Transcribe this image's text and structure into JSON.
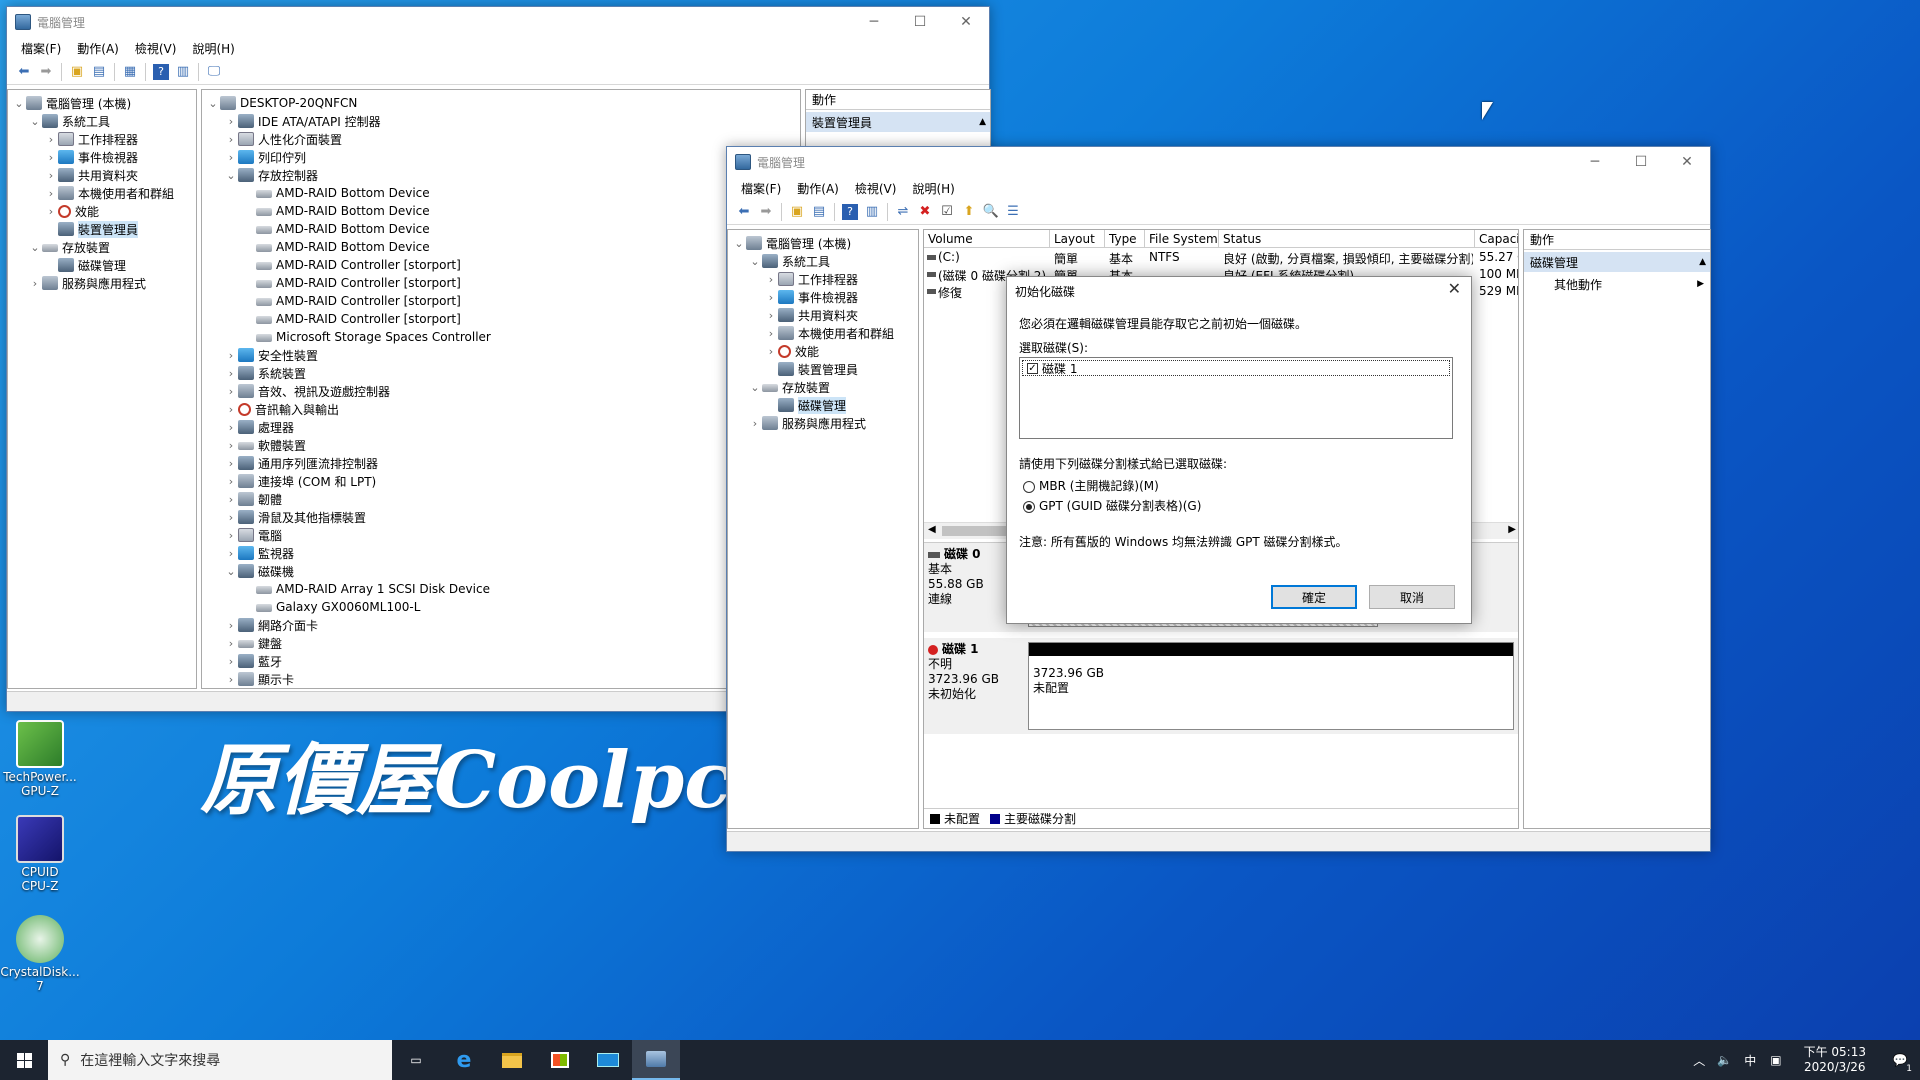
{
  "win1": {
    "title": "電腦管理",
    "menu": [
      "檔案(F)",
      "動作(A)",
      "檢視(V)",
      "說明(H)"
    ],
    "tree": [
      {
        "label": "電腦管理 (本機)",
        "level": 0,
        "exp": "v"
      },
      {
        "label": "系統工具",
        "level": 1,
        "exp": "v"
      },
      {
        "label": "工作排程器",
        "level": 2,
        "exp": ">"
      },
      {
        "label": "事件檢視器",
        "level": 2,
        "exp": ">"
      },
      {
        "label": "共用資料夾",
        "level": 2,
        "exp": ">"
      },
      {
        "label": "本機使用者和群組",
        "level": 2,
        "exp": ">"
      },
      {
        "label": "效能",
        "level": 2,
        "exp": ">"
      },
      {
        "label": "裝置管理員",
        "level": 2,
        "exp": "",
        "selected": true
      },
      {
        "label": "存放裝置",
        "level": 1,
        "exp": "v"
      },
      {
        "label": "磁碟管理",
        "level": 2,
        "exp": ""
      },
      {
        "label": "服務與應用程式",
        "level": 1,
        "exp": ">"
      }
    ],
    "devices": [
      {
        "label": "DESKTOP-20QNFCN",
        "level": 0,
        "exp": "v"
      },
      {
        "label": "IDE ATA/ATAPI 控制器",
        "level": 1,
        "exp": ">"
      },
      {
        "label": "人性化介面裝置",
        "level": 1,
        "exp": ">"
      },
      {
        "label": "列印佇列",
        "level": 1,
        "exp": ">"
      },
      {
        "label": "存放控制器",
        "level": 1,
        "exp": "v"
      },
      {
        "label": "AMD-RAID Bottom Device",
        "level": 2,
        "exp": ""
      },
      {
        "label": "AMD-RAID Bottom Device",
        "level": 2,
        "exp": ""
      },
      {
        "label": "AMD-RAID Bottom Device",
        "level": 2,
        "exp": ""
      },
      {
        "label": "AMD-RAID Bottom Device",
        "level": 2,
        "exp": ""
      },
      {
        "label": "AMD-RAID Controller [storport]",
        "level": 2,
        "exp": ""
      },
      {
        "label": "AMD-RAID Controller [storport]",
        "level": 2,
        "exp": ""
      },
      {
        "label": "AMD-RAID Controller [storport]",
        "level": 2,
        "exp": ""
      },
      {
        "label": "AMD-RAID Controller [storport]",
        "level": 2,
        "exp": ""
      },
      {
        "label": "Microsoft Storage Spaces Controller",
        "level": 2,
        "exp": ""
      },
      {
        "label": "安全性裝置",
        "level": 1,
        "exp": ">"
      },
      {
        "label": "系統裝置",
        "level": 1,
        "exp": ">"
      },
      {
        "label": "音效、視訊及遊戲控制器",
        "level": 1,
        "exp": ">"
      },
      {
        "label": "音訊輸入與輸出",
        "level": 1,
        "exp": ">"
      },
      {
        "label": "處理器",
        "level": 1,
        "exp": ">"
      },
      {
        "label": "軟體裝置",
        "level": 1,
        "exp": ">"
      },
      {
        "label": "通用序列匯流排控制器",
        "level": 1,
        "exp": ">"
      },
      {
        "label": "連接埠 (COM 和 LPT)",
        "level": 1,
        "exp": ">"
      },
      {
        "label": "韌體",
        "level": 1,
        "exp": ">"
      },
      {
        "label": "滑鼠及其他指標裝置",
        "level": 1,
        "exp": ">"
      },
      {
        "label": "電腦",
        "level": 1,
        "exp": ">"
      },
      {
        "label": "監視器",
        "level": 1,
        "exp": ">"
      },
      {
        "label": "磁碟機",
        "level": 1,
        "exp": "v"
      },
      {
        "label": "AMD-RAID Array 1  SCSI Disk Device",
        "level": 2,
        "exp": ""
      },
      {
        "label": "Galaxy GX0060ML100-L",
        "level": 2,
        "exp": ""
      },
      {
        "label": "網路介面卡",
        "level": 1,
        "exp": ">"
      },
      {
        "label": "鍵盤",
        "level": 1,
        "exp": ">"
      },
      {
        "label": "藍牙",
        "level": 1,
        "exp": ">"
      },
      {
        "label": "顯示卡",
        "level": 1,
        "exp": ">"
      }
    ],
    "actions_header": "動作",
    "actions_sub": "裝置管理員"
  },
  "win2": {
    "title": "電腦管理",
    "menu": [
      "檔案(F)",
      "動作(A)",
      "檢視(V)",
      "說明(H)"
    ],
    "tree": [
      {
        "label": "電腦管理 (本機)",
        "level": 0,
        "exp": "v"
      },
      {
        "label": "系統工具",
        "level": 1,
        "exp": "v"
      },
      {
        "label": "工作排程器",
        "level": 2,
        "exp": ">"
      },
      {
        "label": "事件檢視器",
        "level": 2,
        "exp": ">"
      },
      {
        "label": "共用資料夾",
        "level": 2,
        "exp": ">"
      },
      {
        "label": "本機使用者和群組",
        "level": 2,
        "exp": ">"
      },
      {
        "label": "效能",
        "level": 2,
        "exp": ">"
      },
      {
        "label": "裝置管理員",
        "level": 2,
        "exp": ""
      },
      {
        "label": "存放裝置",
        "level": 1,
        "exp": "v"
      },
      {
        "label": "磁碟管理",
        "level": 2,
        "exp": "",
        "selected": true
      },
      {
        "label": "服務與應用程式",
        "level": 1,
        "exp": ">"
      }
    ],
    "columns": [
      "Volume",
      "Layout",
      "Type",
      "File System",
      "Status",
      "Capaci"
    ],
    "volumes": [
      {
        "volume": "(C:)",
        "layout": "簡單",
        "type": "基本",
        "fs": "NTFS",
        "status": "良好 (啟動, 分頁檔案, 損毀傾印, 主要磁碟分割)",
        "cap": "55.27 G"
      },
      {
        "volume": "(磁碟 0 磁碟分割 2)",
        "layout": "簡單",
        "type": "基本",
        "fs": "",
        "status": "良好 (EFI 系統磁碟分割)",
        "cap": "100 ME"
      },
      {
        "volume": "修復",
        "layout": "",
        "type": "",
        "fs": "",
        "status": "",
        "cap": "529 ME"
      }
    ],
    "disk0": {
      "name": "磁碟 0",
      "type": "基本",
      "size": "55.88 GB",
      "state": "連線"
    },
    "disk1": {
      "name": "磁碟 1",
      "type": "不明",
      "size": "3723.96 GB",
      "state": "未初始化",
      "part_size": "3723.96 GB",
      "part_state": "未配置"
    },
    "legend": [
      {
        "label": "未配置",
        "color": "#000000"
      },
      {
        "label": "主要磁碟分割",
        "color": "#00008b"
      }
    ],
    "actions_header": "動作",
    "actions_sub": "磁碟管理",
    "actions_more": "其他動作"
  },
  "dialog": {
    "title": "初始化磁碟",
    "intro": "您必須在邏輯磁碟管理員能存取它之前初始一個磁碟。",
    "select_label": "選取磁碟(S):",
    "disk_item": "磁碟 1",
    "style_label": "請使用下列磁碟分割樣式給已選取磁碟:",
    "mbr": "MBR (主開機記錄)(M)",
    "gpt": "GPT (GUID 磁碟分割表格)(G)",
    "note": "注意: 所有舊版的 Windows 均無法辨識 GPT 磁碟分割樣式。",
    "ok": "確定",
    "cancel": "取消"
  },
  "desktop": {
    "logo": "原價屋Coolpc",
    "icons": [
      {
        "label": "TechPower...\nGPU-Z"
      },
      {
        "label": "CPUID\nCPU-Z"
      },
      {
        "label": "CrystalDisk...\n7"
      }
    ]
  },
  "taskbar": {
    "search_placeholder": "在這裡輸入文字來搜尋",
    "ime": "中",
    "time": "下午 05:13",
    "date": "2020/3/26",
    "notif_count": "1"
  }
}
